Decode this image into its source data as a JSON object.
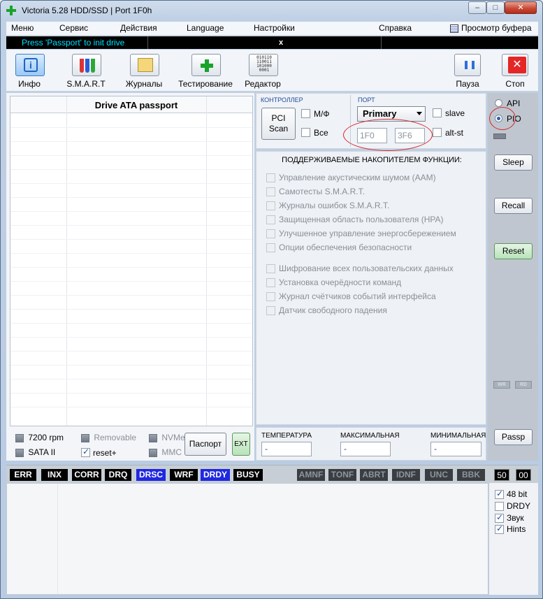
{
  "window": {
    "title": "Victoria 5.28 HDD/SSD | Port 1F0h",
    "minimize_glyph": "–",
    "maximize_glyph": "□",
    "close_glyph": "✕"
  },
  "menu": {
    "items": [
      "Меню",
      "Сервис",
      "Действия",
      "Language",
      "Настройки",
      "Справка"
    ],
    "buffer_view": "Просмотр буфера"
  },
  "status": {
    "message": "Press 'Passport' to init drive",
    "close_glyph": "x"
  },
  "toolbar": {
    "info": "Инфо",
    "smart": "S.M.A.R.T",
    "journals": "Журналы",
    "testing": "Тестирование",
    "editor": "Редактор",
    "pause": "Пауза",
    "stop": "Стоп",
    "info_glyph": "i",
    "stop_glyph": "✕",
    "editor_binary": [
      "010110",
      "110011",
      "101000",
      "0001"
    ]
  },
  "passport_grid": {
    "title": "Drive ATA passport"
  },
  "drive_flags": {
    "rpm": "7200 rpm",
    "sata": "SATA II",
    "removable": "Removable",
    "reset_plus": "reset+",
    "nvme": "NVMe",
    "mmc": "MMC",
    "passport_button": "Паспорт",
    "ext_button": "EXT"
  },
  "controller": {
    "label": "КОНТРОЛЛЕР",
    "pci_scan_line1": "PCI",
    "pci_scan_line2": "Scan",
    "mf": "М/Ф",
    "all": "Все"
  },
  "port": {
    "label": "ПОРТ",
    "selected": "Primary",
    "slave": "slave",
    "alt_st": "alt-st",
    "base": "1F0",
    "alt": "3F6"
  },
  "features": {
    "title": "ПОДДЕРЖИВАЕМЫЕ НАКОПИТЕЛЕМ ФУНКЦИИ:",
    "group1": [
      "Управление акустическим шумом (AAM)",
      "Самотесты S.M.A.R.T.",
      "Журналы ошибок S.M.A.R.T.",
      "Защищенная область пользователя (HPA)",
      "Улучшенное управление энергосбережением",
      "Опции обеспечения безопасности"
    ],
    "group2": [
      "Шифрование всех пользовательских данных",
      "Установка очерёдности команд",
      "Журнал счётчиков событий интерфейса",
      "Датчик свободного падения"
    ]
  },
  "temperature": {
    "current_label": "ТЕМПЕРАТУРА",
    "max_label": "МАКСИМАЛЬНАЯ",
    "min_label": "МИНИМАЛЬНАЯ",
    "current": "-",
    "max": "-",
    "min": "-"
  },
  "side": {
    "api": "API",
    "pio": "PIO",
    "sleep": "Sleep",
    "recall": "Recall",
    "reset": "Reset",
    "wr": "WR",
    "rd": "RD",
    "passp": "Passp"
  },
  "flags": {
    "active": [
      "ERR",
      "INX",
      "CORR",
      "DRQ",
      "DRSC",
      "WRF",
      "DRDY",
      "BUSY"
    ],
    "dim": [
      "AMNF",
      "TONF",
      "ABRT",
      "IDNF",
      "UNC",
      "BBK"
    ],
    "counter1": "50",
    "counter2": "00"
  },
  "options": {
    "bit48": "48 bit",
    "drdy": "DRDY",
    "sound": "Звук",
    "hints": "Hints"
  },
  "colors": {
    "status_text": "#00e0ff",
    "flag_blue": "#1f28e0",
    "annotation": "#d8272b"
  }
}
